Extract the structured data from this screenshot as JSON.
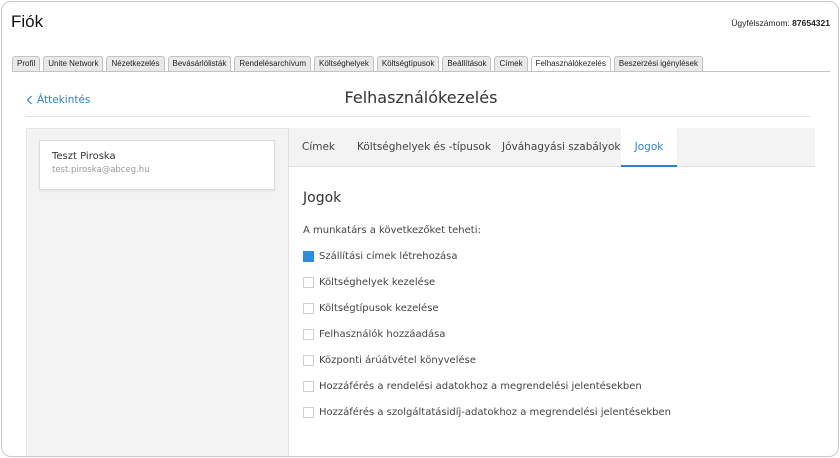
{
  "header": {
    "title": "Fiók",
    "customer_label": "Ügyfélszámom:",
    "customer_number": "87654321"
  },
  "tabs": [
    {
      "label": "Profil",
      "active": false
    },
    {
      "label": "Unite Network",
      "active": false
    },
    {
      "label": "Nézetkezelés",
      "active": false
    },
    {
      "label": "Bevásárlólisták",
      "active": false
    },
    {
      "label": "Rendelésarchívum",
      "active": false
    },
    {
      "label": "Költséghelyek",
      "active": false
    },
    {
      "label": "Költségtípusok",
      "active": false
    },
    {
      "label": "Beállítások",
      "active": false
    },
    {
      "label": "Címek",
      "active": false
    },
    {
      "label": "Felhasználókezelés",
      "active": true
    },
    {
      "label": "Beszerzési igénylések",
      "active": false
    }
  ],
  "page": {
    "back_label": "Áttekintés",
    "title": "Felhasználókezelés"
  },
  "user": {
    "name": "Teszt Piroska",
    "email": "test.piroska@abceg.hu"
  },
  "subtabs": [
    {
      "label": "Címek",
      "active": false
    },
    {
      "label": "Költséghelyek és -típusok",
      "active": false
    },
    {
      "label": "Jóváhagyási szabályok",
      "active": false
    },
    {
      "label": "Jogok",
      "active": true
    }
  ],
  "rights": {
    "title": "Jogok",
    "intro": "A munkatárs a következőket teheti:",
    "items": [
      {
        "label": "Szállítási címek létrehozása",
        "checked": true
      },
      {
        "label": "Költséghelyek kezelése",
        "checked": false
      },
      {
        "label": "Költségtípusok kezelése",
        "checked": false
      },
      {
        "label": "Felhasználók hozzáadása",
        "checked": false
      },
      {
        "label": "Központi árúátvétel könyvelése",
        "checked": false
      },
      {
        "label": "Hozzáférés a rendelési adatokhoz a megrendelési jelentésekben",
        "checked": false
      },
      {
        "label": "Hozzáférés a szolgáltatásidíj-adatokhoz a megrendelési jelentésekben",
        "checked": false
      }
    ]
  },
  "colors": {
    "accent": "#2d7fd6",
    "checkbox_checked": "#2d8ee0"
  },
  "icons": {
    "back": "chevron-left-icon"
  }
}
